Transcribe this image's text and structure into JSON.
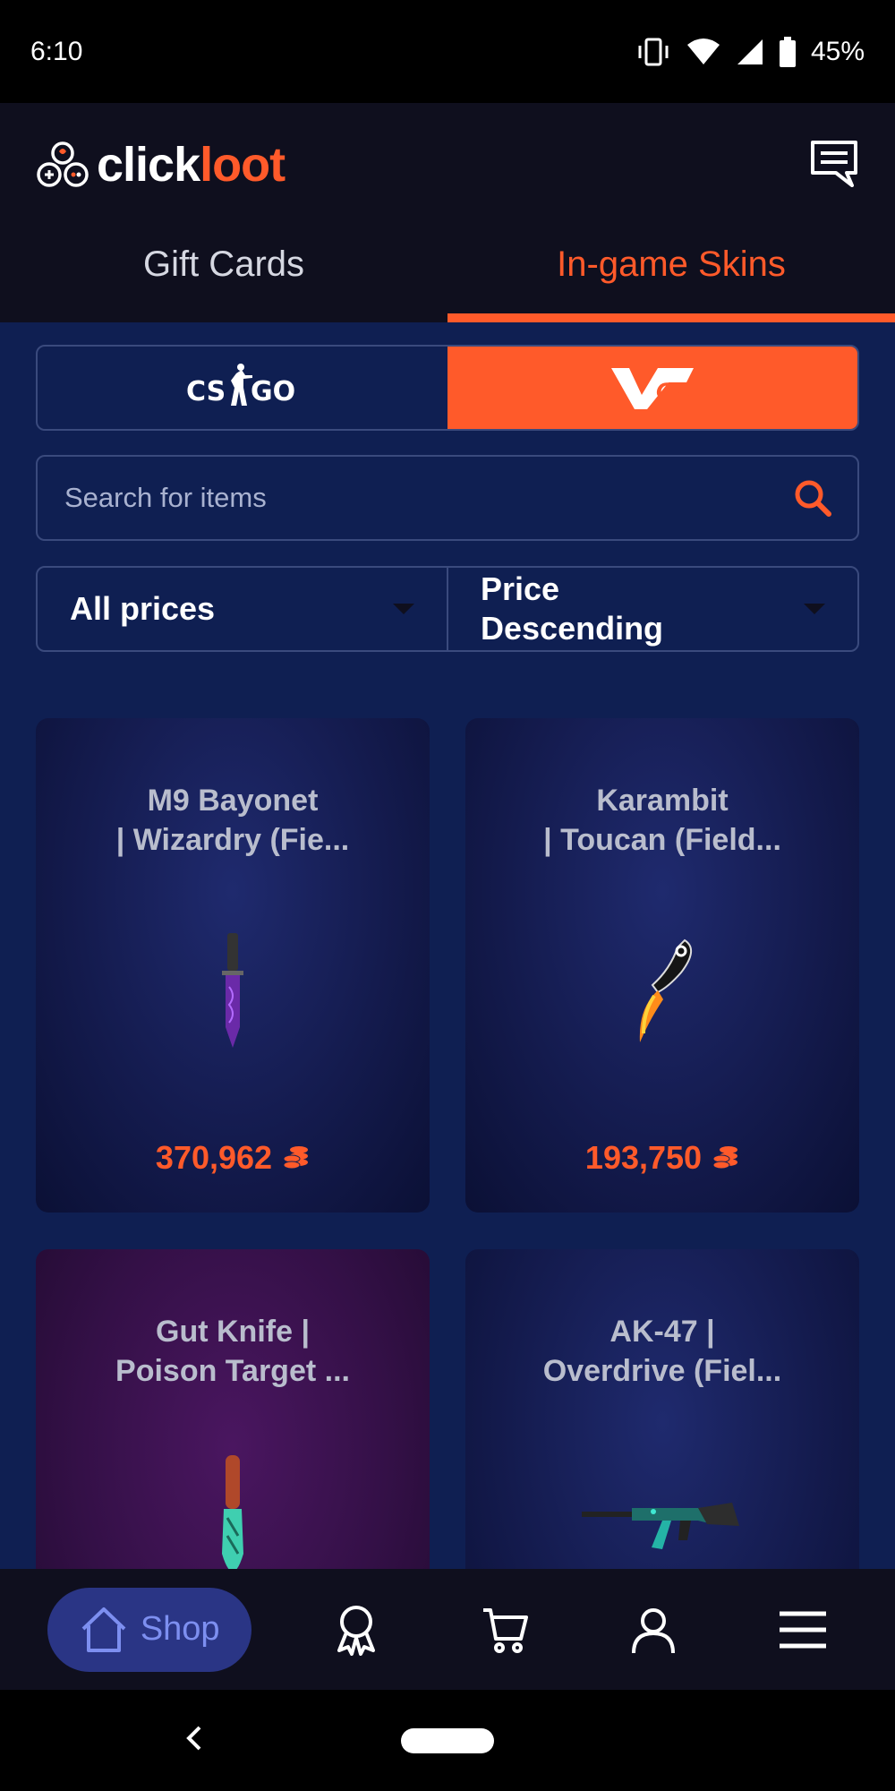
{
  "status": {
    "time": "6:10",
    "battery": "45%"
  },
  "header": {
    "logo_part1": "click",
    "logo_part2": "loot"
  },
  "tabs": [
    {
      "label": "Gift Cards",
      "active": false
    },
    {
      "label": "In-game Skins",
      "active": true
    }
  ],
  "games": [
    {
      "label": "CS GO",
      "icon": "csgo-logo",
      "active": false
    },
    {
      "label": "VGO",
      "icon": "vgo-logo",
      "active": true
    }
  ],
  "search": {
    "placeholder": "Search for items",
    "value": ""
  },
  "filters": {
    "price": "All prices",
    "sort_line1": "Price",
    "sort_line2": "Descending"
  },
  "items": [
    {
      "title_line1": "M9 Bayonet",
      "title_line2": "| Wizardry (Fie...",
      "price": "370,962",
      "image": "m9-bayonet-knife"
    },
    {
      "title_line1": "Karambit",
      "title_line2": "| Toucan (Field...",
      "price": "193,750",
      "image": "karambit-knife"
    },
    {
      "title_line1": "Gut Knife |",
      "title_line2": "Poison Target ...",
      "price": "",
      "image": "gut-knife"
    },
    {
      "title_line1": "AK-47 |",
      "title_line2": "Overdrive (Fiel...",
      "price": "",
      "image": "ak-47-rifle"
    }
  ],
  "nav": {
    "shop_label": "Shop",
    "items": [
      "home-icon",
      "award-icon",
      "cart-icon",
      "user-icon",
      "menu-icon"
    ]
  },
  "colors": {
    "accent": "#ff5a2a",
    "background": "#0f1f52",
    "header": "#0f0f1e",
    "nav_active": "#2a3585"
  }
}
